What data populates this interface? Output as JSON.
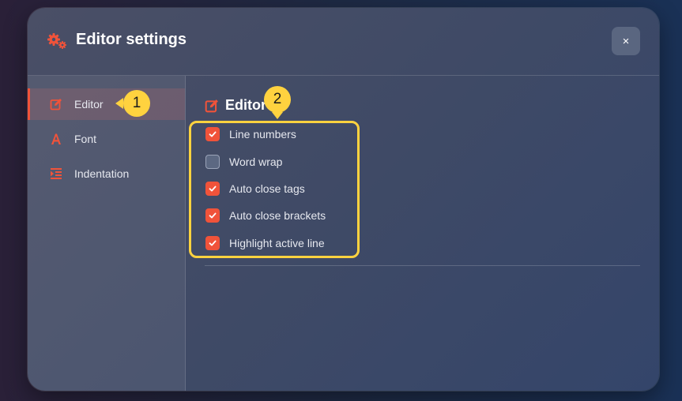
{
  "dialog": {
    "title": "Editor settings",
    "close_label": "×"
  },
  "sidebar": {
    "items": [
      {
        "label": "Editor",
        "icon": "edit-icon",
        "active": true
      },
      {
        "label": "Font",
        "icon": "font-icon",
        "active": false
      },
      {
        "label": "Indentation",
        "icon": "indent-icon",
        "active": false
      }
    ]
  },
  "section": {
    "title": "Editor",
    "options": [
      {
        "label": "Line numbers",
        "checked": true
      },
      {
        "label": "Word wrap",
        "checked": false
      },
      {
        "label": "Auto close tags",
        "checked": true
      },
      {
        "label": "Auto close brackets",
        "checked": true
      },
      {
        "label": "Highlight active line",
        "checked": true
      }
    ]
  },
  "annotations": {
    "badge1": "1",
    "badge2": "2"
  },
  "colors": {
    "accent": "#f0533a",
    "highlight": "#ffd23f"
  }
}
